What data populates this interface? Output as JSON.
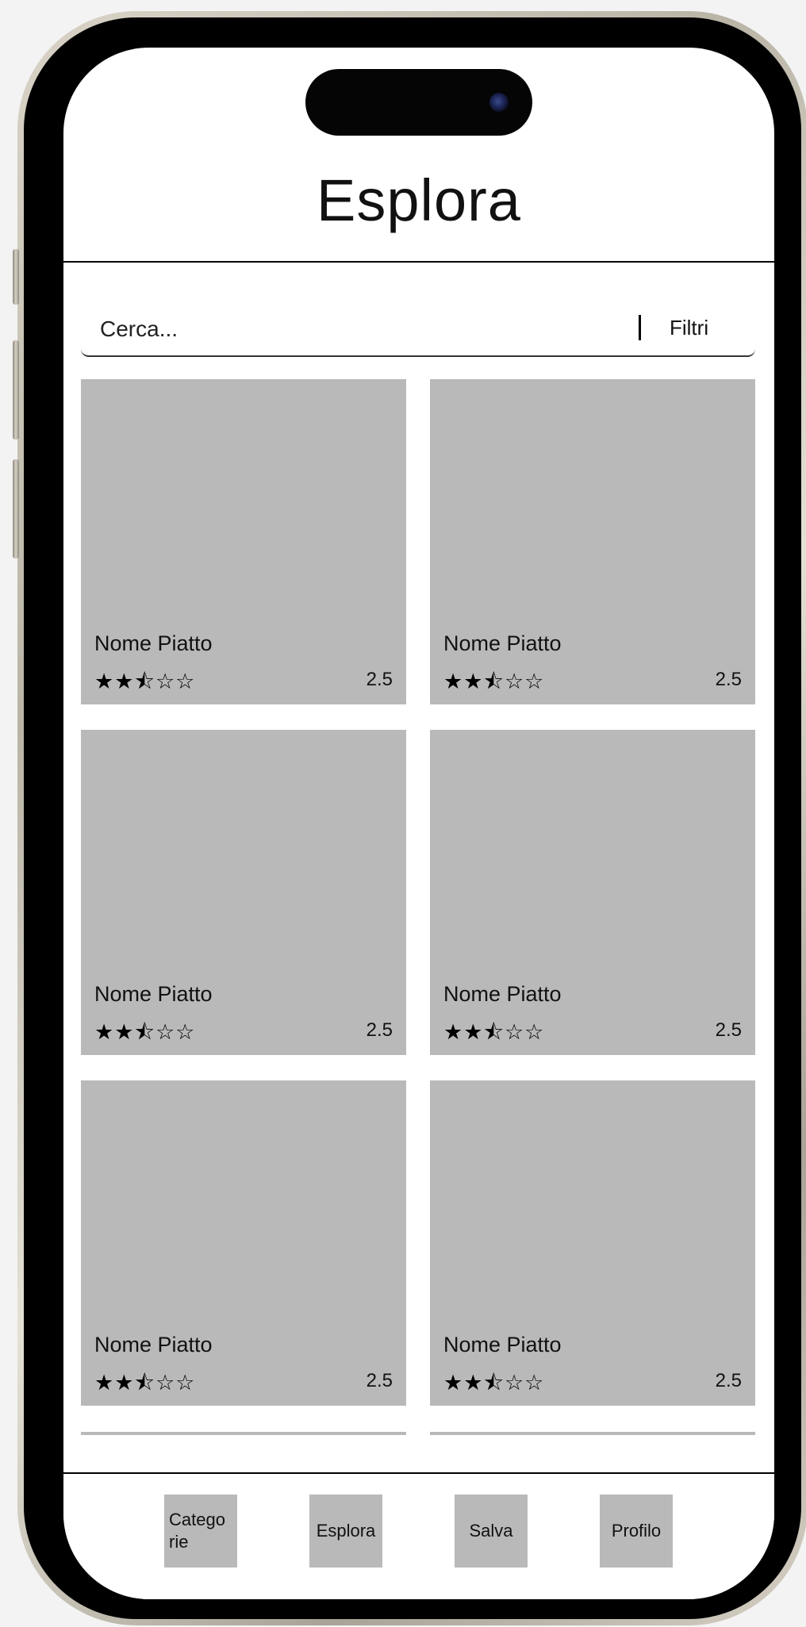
{
  "header": {
    "title": "Esplora"
  },
  "search": {
    "placeholder": "Cerca...",
    "filter_label": "Filtri"
  },
  "cards": [
    {
      "name": "Nome Piatto",
      "stars": "★★⯪☆☆",
      "score": "2.5",
      "rating": 2.5
    },
    {
      "name": "Nome Piatto",
      "stars": "★★⯪☆☆",
      "score": "2.5",
      "rating": 2.5
    },
    {
      "name": "Nome Piatto",
      "stars": "★★⯪☆☆",
      "score": "2.5",
      "rating": 2.5
    },
    {
      "name": "Nome Piatto",
      "stars": "★★⯪☆☆",
      "score": "2.5",
      "rating": 2.5
    },
    {
      "name": "Nome Piatto",
      "stars": "★★⯪☆☆",
      "score": "2.5",
      "rating": 2.5
    },
    {
      "name": "Nome Piatto",
      "stars": "★★⯪☆☆",
      "score": "2.5",
      "rating": 2.5
    }
  ],
  "bottom_nav": {
    "items": [
      {
        "label": "Catego rie"
      },
      {
        "label": "Esplora"
      },
      {
        "label": "Salva"
      },
      {
        "label": "Profilo"
      }
    ]
  }
}
